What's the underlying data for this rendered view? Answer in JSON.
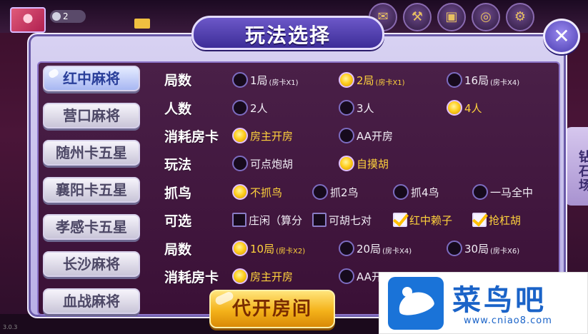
{
  "background": {
    "top_pill_text": "2",
    "title_ghost_text": "",
    "side_tab_label": "钻石场",
    "bottom_left_text": "3.0.3"
  },
  "dialog": {
    "title": "玩法选择",
    "close_label": "✕"
  },
  "games": [
    {
      "label": "红中麻将",
      "active": true
    },
    {
      "label": "营口麻将",
      "active": false
    },
    {
      "label": "随州卡五星",
      "active": false
    },
    {
      "label": "襄阳卡五星",
      "active": false
    },
    {
      "label": "孝感卡五星",
      "active": false
    },
    {
      "label": "长沙麻将",
      "active": false
    },
    {
      "label": "血战麻将",
      "active": false
    }
  ],
  "rows": {
    "rounds1": {
      "label": "局数",
      "options": [
        {
          "text": "1局",
          "sub": "(房卡X1)",
          "selected": false
        },
        {
          "text": "2局",
          "sub": "(房卡X1)",
          "selected": true
        },
        {
          "text": "16局",
          "sub": "(房卡X4)",
          "selected": false
        }
      ]
    },
    "players": {
      "label": "人数",
      "options": [
        {
          "text": "2人",
          "selected": false
        },
        {
          "text": "3人",
          "selected": false
        },
        {
          "text": "4人",
          "selected": true
        }
      ]
    },
    "card_cost1": {
      "label": "消耗房卡",
      "options": [
        {
          "text": "房主开房",
          "selected": true
        },
        {
          "text": "AA开房",
          "selected": false
        }
      ]
    },
    "play": {
      "label": "玩法",
      "options": [
        {
          "text": "可点炮胡",
          "selected": false
        },
        {
          "text": "自摸胡",
          "selected": true
        }
      ]
    },
    "birds": {
      "label": "抓鸟",
      "options": [
        {
          "text": "不抓鸟",
          "selected": true
        },
        {
          "text": "抓2鸟",
          "selected": false
        },
        {
          "text": "抓4鸟",
          "selected": false
        },
        {
          "text": "一马全中",
          "selected": false
        }
      ]
    },
    "extras": {
      "label": "可选",
      "options": [
        {
          "text": "庄闲（算分",
          "selected": false
        },
        {
          "text": "可胡七对",
          "selected": false
        },
        {
          "text": "红中赖子",
          "selected": true
        },
        {
          "text": "抢杠胡",
          "selected": true
        }
      ]
    },
    "rounds2": {
      "label": "局数",
      "options": [
        {
          "text": "10局",
          "sub": "(房卡X2)",
          "selected": true
        },
        {
          "text": "20局",
          "sub": "(房卡X4)",
          "selected": false
        },
        {
          "text": "30局",
          "sub": "(房卡X6)",
          "selected": false
        }
      ]
    },
    "card_cost2": {
      "label": "消耗房卡",
      "options": [
        {
          "text": "房主开房",
          "selected": true
        },
        {
          "text": "AA开",
          "selected": false
        }
      ]
    }
  },
  "actions": {
    "open_room_label": "代开房间"
  },
  "watermark": {
    "title": "菜鸟吧",
    "url": "www.cniao8.com"
  },
  "colors": {
    "selected_text": "#ffd23c",
    "dialog_inner": "#4a2048",
    "title_plate": "#5a48b8",
    "action_button": "#f4b21a"
  }
}
